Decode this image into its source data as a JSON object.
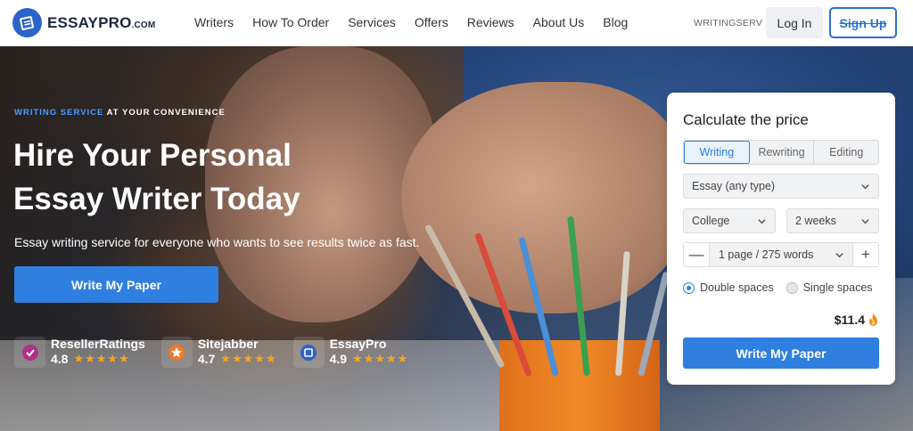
{
  "brand": {
    "name": "ESSAYPRO",
    "domain": ".COM",
    "color": "#2c63c9"
  },
  "nav": {
    "items": [
      "Writers",
      "How To Order",
      "Services",
      "Offers",
      "Reviews",
      "About Us",
      "Blog"
    ],
    "promo_code": "WRITINGSERV",
    "login_label": "Log In",
    "signup_label": "Sign Up"
  },
  "hero": {
    "eyebrow_accent": "WRITING SERVICE",
    "eyebrow_rest": " AT YOUR CONVENIENCE",
    "headline_line1": "Hire Your Personal",
    "headline_line2": "Essay Writer Today",
    "subtext": "Essay writing service for everyone who wants to see results twice as fast.",
    "cta_label": "Write My Paper",
    "ratings": [
      {
        "name": "ResellerRatings",
        "score": "4.8",
        "stars": "★★★★★",
        "icon": "check-badge-icon"
      },
      {
        "name": "Sitejabber",
        "score": "4.7",
        "stars": "★★★★★",
        "icon": "star-badge-icon"
      },
      {
        "name": "EssayPro",
        "score": "4.9",
        "stars": "★★★★★",
        "icon": "essaypro-badge-icon"
      }
    ]
  },
  "calculator": {
    "title": "Calculate the price",
    "tabs": [
      "Writing",
      "Rewriting",
      "Editing"
    ],
    "active_tab": "Writing",
    "paper_type": "Essay (any type)",
    "level": "College",
    "deadline": "2 weeks",
    "pages": "1 page / 275 words",
    "decrement": "—",
    "increment": "+",
    "spacing_options": [
      "Double spaces",
      "Single spaces"
    ],
    "selected_spacing": "Double spaces",
    "price": "$11.4",
    "cta_label": "Write My Paper"
  },
  "colors": {
    "accent": "#2f7fe0",
    "star": "#f5a623"
  }
}
